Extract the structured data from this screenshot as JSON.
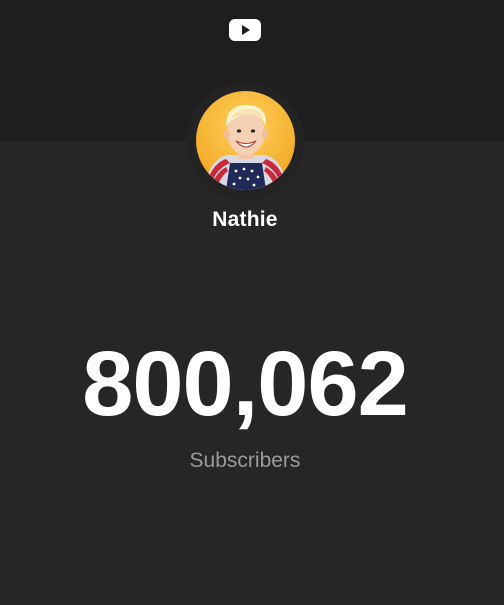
{
  "header": {
    "logo_icon": "youtube-play-icon",
    "logo_color": "#ffffff"
  },
  "channel": {
    "name": "Nathie",
    "avatar_icon": "avatar-photo"
  },
  "stats": {
    "subscriber_count": "800,062",
    "subscriber_label": "Subscribers"
  },
  "colors": {
    "background": "#262626",
    "top_band": "#1e1e1e",
    "count_text": "#ffffff",
    "label_text": "#9a9a9a",
    "avatar_bg": "#f5b631"
  }
}
